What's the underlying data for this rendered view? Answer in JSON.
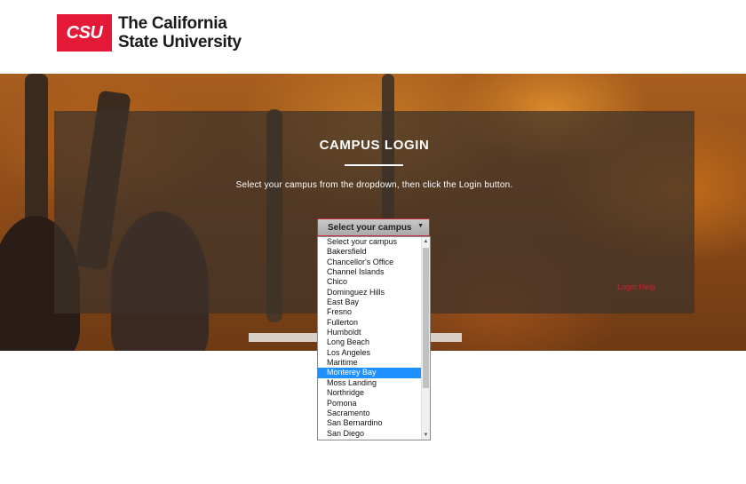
{
  "brand": {
    "logo_mark": "CSU",
    "name_line1": "The California",
    "name_line2": "State University",
    "color": "#e31937"
  },
  "login": {
    "title": "CAMPUS LOGIN",
    "instructions": "Select your campus from the dropdown, then click the Login button.",
    "help_link": "Login Help",
    "link_color": "#cc2233"
  },
  "campus_select": {
    "selected_label": "Select your campus",
    "arrow_icon": "triangle-down",
    "options": [
      "Select your campus",
      "Bakersfield",
      "Chancellor's Office",
      "Channel Islands",
      "Chico",
      "Dominguez Hills",
      "East Bay",
      "Fresno",
      "Fullerton",
      "Humboldt",
      "Long Beach",
      "Los Angeles",
      "Maritime",
      "Monterey Bay",
      "Moss Landing",
      "Northridge",
      "Pomona",
      "Sacramento",
      "San Bernardino",
      "San Diego"
    ],
    "highlighted_option": "Monterey Bay",
    "highlight_color": "#1e90ff"
  }
}
